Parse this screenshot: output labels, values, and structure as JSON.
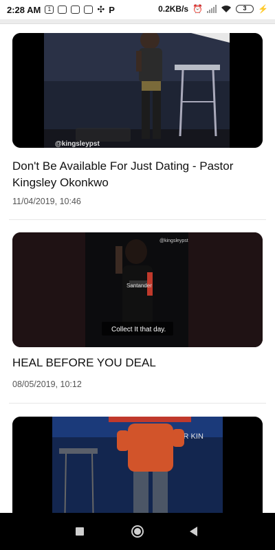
{
  "status_bar": {
    "time": "2:28 AM",
    "speed": "0.2KB/s",
    "battery": "3",
    "icons": [
      "notification-1-icon",
      "mail-icon",
      "mail-icon",
      "mail-icon",
      "pinwheel-icon",
      "p-icon",
      "alarm-icon",
      "signal-icon",
      "wifi-icon",
      "battery-icon",
      "charging-icon"
    ]
  },
  "feed": {
    "items": [
      {
        "title": "Don't Be Available For Just Dating - Pastor Kingsley Okonkwo",
        "date": "11/04/2019, 10:46",
        "watermark": "@kingsleypst",
        "thumb_desc": "Man speaking at podium on stage"
      },
      {
        "title": "HEAL BEFORE YOU DEAL",
        "date": "08/05/2019, 10:12",
        "watermark": "@kingsleypst",
        "caption": "Collect It that day.",
        "shirt_text": "Santander",
        "thumb_desc": "Man in black shirt holding microphone"
      },
      {
        "title": "",
        "date": "",
        "stage_text": "OR KIN",
        "thumb_desc": "Man in orange jacket on stage"
      }
    ]
  },
  "navbar": {
    "icons": [
      "recent-apps-icon",
      "home-icon",
      "back-icon"
    ]
  },
  "colors": {
    "background": "#ffffff",
    "title_text": "#111111",
    "date_text": "#555555",
    "navbar": "#000000"
  }
}
